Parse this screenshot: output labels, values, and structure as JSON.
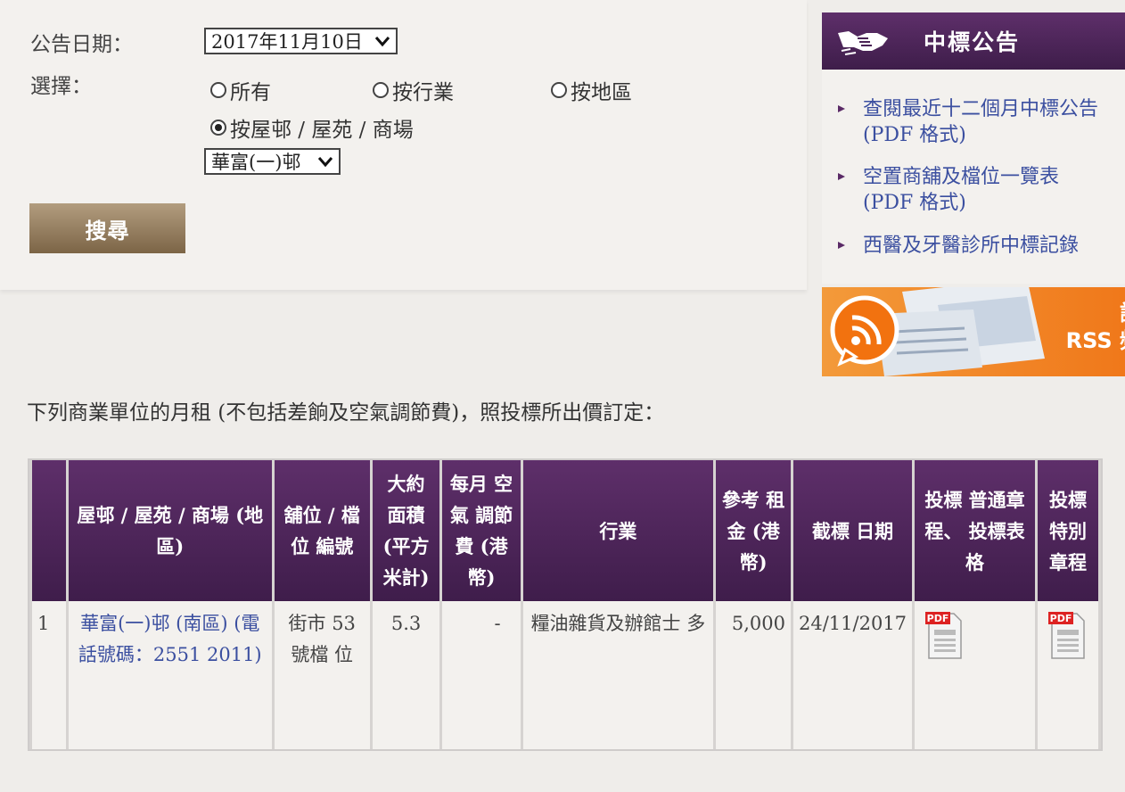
{
  "search": {
    "date_label": "公告日期：",
    "date_value": "2017年11月10日",
    "choice_label": "選擇：",
    "options": [
      {
        "label": "所有",
        "selected": false
      },
      {
        "label": "按行業",
        "selected": false
      },
      {
        "label": "按地區",
        "selected": false
      },
      {
        "label": "按屋邨 / 屋苑 / 商場",
        "selected": true
      }
    ],
    "estate_value": "華富(一)邨",
    "button_label": "搜尋"
  },
  "sidebar": {
    "title": "中標公告",
    "links": [
      {
        "label": "查閱最近十二個月中標公告 (PDF 格式)"
      },
      {
        "label": "空置商舖及檔位一覽表 (PDF 格式)"
      },
      {
        "label": "西醫及牙醫診所中標記錄"
      }
    ],
    "rss": {
      "line1": "訂閱",
      "line2": "RSS 頻道"
    }
  },
  "intro": "下列商業單位的月租 (不包括差餉及空氣調節費)，照投標所出價訂定：",
  "table": {
    "headers": {
      "estate": "屋邨 / 屋苑 / 商場 (地區)",
      "shop": "舖位 / 檔位 編號",
      "area": "大約 面積 (平方 米計)",
      "ac_fee": "每月 空氣 調節費 (港幣)",
      "trade": "行業",
      "rent": "參考 租金 (港幣)",
      "closing": "截標 日期",
      "general": "投標 普通章程、 投標表格",
      "special": "投標 特別 章程"
    },
    "rows": [
      {
        "no": "1",
        "estate": "華富(一)邨 (南區) (電話號碼：2551 2011)",
        "shop": "街市 53號檔 位",
        "area": "5.3",
        "ac_fee": "-",
        "trade": "糧油雜貨及辦館士 多",
        "rent": "5,000",
        "closing": "24/11/2017",
        "general_icon": "pdf-icon",
        "special_icon": "pdf-icon"
      }
    ]
  },
  "colors": {
    "accent": "#4a2356",
    "link": "#3b4fa0",
    "button": "#9a8463",
    "rss": "#f0821f"
  }
}
